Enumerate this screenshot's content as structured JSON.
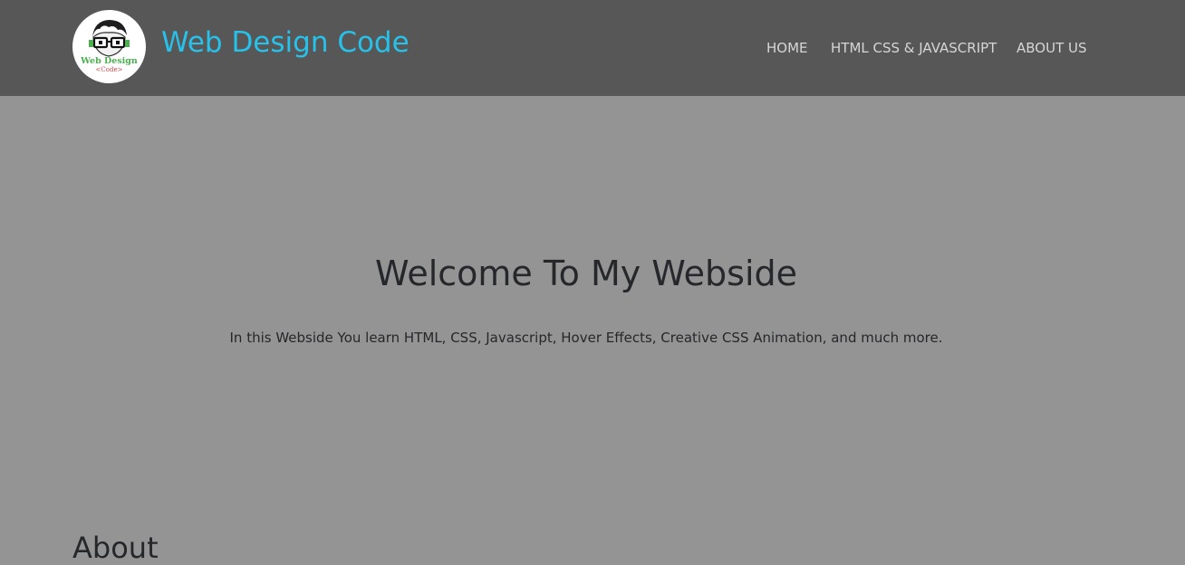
{
  "header": {
    "logo": {
      "icon": "nerd-glasses-avatar-icon",
      "line1": "Web Design",
      "line2": "<Code>"
    },
    "brand": "Web Design Code",
    "nav": [
      {
        "label": "HOME"
      },
      {
        "label": "HTML CSS & JAVASCRIPT"
      },
      {
        "label": "ABOUT US"
      }
    ]
  },
  "hero": {
    "title": "Welcome To My Webside",
    "text": "In this Webside You learn HTML, CSS, Javascript, Hover Effects, Creative CSS Animation, and much more."
  },
  "about": {
    "heading": "About"
  },
  "colors": {
    "navbar_bg": "#575757",
    "page_bg": "#949494",
    "brand": "#27c1ea",
    "nav_link": "#d6d6d6",
    "text": "#25272b"
  }
}
